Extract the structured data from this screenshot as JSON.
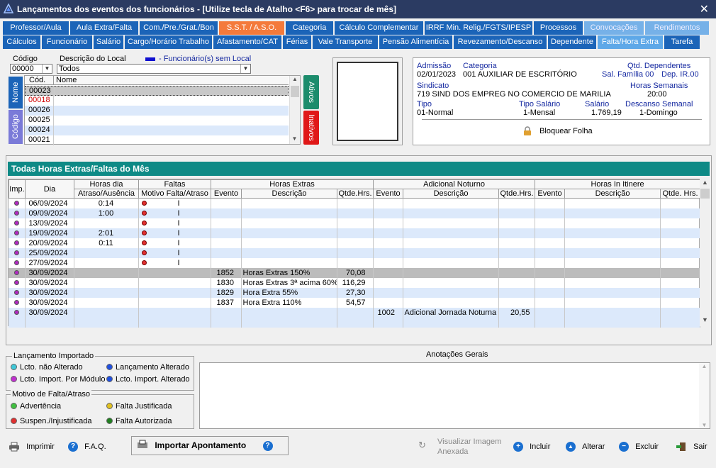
{
  "window": {
    "title": "Lançamentos dos eventos dos funcionários - [Utilize tecla de Atalho <F6> para trocar de mês]"
  },
  "tabs_row1": [
    {
      "label": "Professor/Aula",
      "w": 93,
      "style": "blue"
    },
    {
      "label": "Aula Extra/Falta",
      "w": 96,
      "style": "blue"
    },
    {
      "label": "Com./Pre./Grat./Bon",
      "w": 110,
      "style": "blue"
    },
    {
      "label": "S.S.T. / A.S.O.",
      "w": 92,
      "style": "orange"
    },
    {
      "label": "Categoria",
      "w": 67,
      "style": "blue"
    },
    {
      "label": "Cálculo Complementar",
      "w": 125,
      "style": "blue"
    },
    {
      "label": "IRRF Min. Relig./FGTS/IPESP",
      "w": 152,
      "style": "blue"
    },
    {
      "label": "Processos",
      "w": 69,
      "style": "blue"
    },
    {
      "label": "Convocações",
      "w": 84,
      "style": "light"
    },
    {
      "label": "Rendimentos",
      "w": 90,
      "style": "light"
    }
  ],
  "tabs_row2": [
    {
      "label": "Cálculos",
      "w": 53,
      "style": "blue"
    },
    {
      "label": "Funcionário",
      "w": 71,
      "style": "blue"
    },
    {
      "label": "Salário",
      "w": 42,
      "style": "blue"
    },
    {
      "label": "Cargo/Horário Trabalho",
      "w": 123,
      "style": "blue"
    },
    {
      "label": "Afastamento/CAT",
      "w": 96,
      "style": "blue"
    },
    {
      "label": "Férias",
      "w": 40,
      "style": "blue"
    },
    {
      "label": "Vale Transporte",
      "w": 92,
      "style": "blue"
    },
    {
      "label": "Pensão Alimentícia",
      "w": 103,
      "style": "blue"
    },
    {
      "label": "Revezamento/Descanso",
      "w": 131,
      "style": "blue"
    },
    {
      "label": "Dependente",
      "w": 68,
      "style": "blue"
    },
    {
      "label": "Falta/Hora Extra",
      "w": 92,
      "style": "active"
    },
    {
      "label": "Tarefa",
      "w": 50,
      "style": "blue"
    }
  ],
  "filter": {
    "codigo_label": "Código",
    "codigo_value": "00000",
    "descricao_label": "Descrição do Local",
    "descricao_value": "Todos",
    "legend_text": "- Funcionário(s) sem Local",
    "legend_color": "#1010d0"
  },
  "emp_list": {
    "side_tabs": [
      "Nome",
      "Código"
    ],
    "status_tabs": [
      "Ativos",
      "Inativos"
    ],
    "col_cod": "Cód.",
    "col_nome": "Nome",
    "rows": [
      {
        "cod": "00023",
        "nome": "",
        "red": false
      },
      {
        "cod": "00018",
        "nome": "",
        "red": true
      },
      {
        "cod": "00026",
        "nome": "",
        "red": false
      },
      {
        "cod": "00025",
        "nome": "",
        "red": false
      },
      {
        "cod": "00024",
        "nome": "",
        "red": false
      },
      {
        "cod": "00021",
        "nome": "",
        "red": false
      }
    ]
  },
  "info": {
    "admissao_label": "Admissão",
    "admissao": "02/01/2023",
    "categoria_label": "Categoria",
    "categoria": "001  AUXILIAR DE ESCRITÓRIO",
    "qtd_dep_label": "Qtd. Dependentes",
    "sal_familia": "Sal. Família 00",
    "dep_ir": "Dep. IR.00",
    "sindicato_label": "Sindicato",
    "sindicato": "719  SIND DOS EMPREG NO COMERCIO DE MARILIA",
    "horas_sem_label": "Horas Semanais",
    "horas_sem": "20:00",
    "tipo_label": "Tipo",
    "tipo": "01-Normal",
    "tipo_sal_label": "Tipo Salário",
    "tipo_sal": "1-Mensal",
    "salario_label": "Salário",
    "salario": "1.769,19",
    "descanso_label": "Descanso Semanal",
    "descanso": "1-Domingo",
    "bloquear": "Bloquear Folha"
  },
  "grid": {
    "title": "Todas Horas Extras/Faltas  do Mês",
    "groups": {
      "horas_dia": "Horas dia",
      "faltas": "Faltas",
      "horas_extras": "Horas Extras",
      "adicional": "Adicional Noturno",
      "in_itinere": "Horas In Itinere"
    },
    "cols": {
      "imp": "Imp.",
      "dia": "Dia",
      "atraso": "Atraso/Ausência",
      "motivo": "Motivo Falta/Atraso",
      "evento": "Evento",
      "descricao": "Descrição",
      "qtde": "Qtde.Hrs.",
      "qtde2": "Qtde. Hrs."
    },
    "rows": [
      {
        "dia": "06/09/2024",
        "atraso": "0:14",
        "falta": true,
        "mi": "I",
        "he_ev": "",
        "he_desc": "",
        "he_q": "",
        "an_ev": "",
        "an_desc": "",
        "an_q": ""
      },
      {
        "dia": "09/09/2024",
        "atraso": "1:00",
        "falta": true,
        "mi": "I",
        "he_ev": "",
        "he_desc": "",
        "he_q": "",
        "an_ev": "",
        "an_desc": "",
        "an_q": ""
      },
      {
        "dia": "13/09/2024",
        "atraso": "",
        "falta": true,
        "mi": "I",
        "he_ev": "",
        "he_desc": "",
        "he_q": "",
        "an_ev": "",
        "an_desc": "",
        "an_q": ""
      },
      {
        "dia": "19/09/2024",
        "atraso": "2:01",
        "falta": true,
        "mi": "I",
        "he_ev": "",
        "he_desc": "",
        "he_q": "",
        "an_ev": "",
        "an_desc": "",
        "an_q": ""
      },
      {
        "dia": "20/09/2024",
        "atraso": "0:11",
        "falta": true,
        "mi": "I",
        "he_ev": "",
        "he_desc": "",
        "he_q": "",
        "an_ev": "",
        "an_desc": "",
        "an_q": ""
      },
      {
        "dia": "25/09/2024",
        "atraso": "",
        "falta": true,
        "mi": "I",
        "he_ev": "",
        "he_desc": "",
        "he_q": "",
        "an_ev": "",
        "an_desc": "",
        "an_q": ""
      },
      {
        "dia": "27/09/2024",
        "atraso": "",
        "falta": true,
        "mi": "I",
        "he_ev": "",
        "he_desc": "",
        "he_q": "",
        "an_ev": "",
        "an_desc": "",
        "an_q": ""
      },
      {
        "dia": "30/09/2024",
        "atraso": "",
        "falta": false,
        "mi": "",
        "he_ev": "1852",
        "he_desc": "Horas Extras 150%",
        "he_q": "70,08",
        "an_ev": "",
        "an_desc": "",
        "an_q": ""
      },
      {
        "dia": "30/09/2024",
        "atraso": "",
        "falta": false,
        "mi": "",
        "he_ev": "1830",
        "he_desc": "Horas Extras 3ª acima 60%",
        "he_q": "116,29",
        "an_ev": "",
        "an_desc": "",
        "an_q": ""
      },
      {
        "dia": "30/09/2024",
        "atraso": "",
        "falta": false,
        "mi": "",
        "he_ev": "1829",
        "he_desc": "Hora Extra 55%",
        "he_q": "27,30",
        "an_ev": "",
        "an_desc": "",
        "an_q": ""
      },
      {
        "dia": "30/09/2024",
        "atraso": "",
        "falta": false,
        "mi": "",
        "he_ev": "1837",
        "he_desc": "Hora Extra 110%",
        "he_q": "54,57",
        "an_ev": "",
        "an_desc": "",
        "an_q": ""
      },
      {
        "dia": "30/09/2024",
        "atraso": "",
        "falta": false,
        "mi": "",
        "he_ev": "",
        "he_desc": "",
        "he_q": "",
        "an_ev": "1002",
        "an_desc": "Adicional Jornada Noturna",
        "an_q": "20,55"
      }
    ]
  },
  "legend": {
    "importado_title": "Lançamento Importado",
    "nao_alterado": "Lcto. não Alterado",
    "alterado": "Lançamento Alterado",
    "por_modulo": "Lcto. Import. Por Módulo",
    "import_alterado": "Lcto. Import. Alterado",
    "motivo_title": "Motivo de Falta/Atraso",
    "advertencia": "Advertência",
    "justificada": "Falta Justificada",
    "suspen": "Suspen./Injustificada",
    "autorizada": "Falta Autorizada",
    "colors": {
      "cyan": "#3fc8d8",
      "blue": "#2050e0",
      "magenta": "#c030d0",
      "green": "#40c040",
      "yellow": "#e0c020",
      "red": "#e03030",
      "dkgreen": "#208020"
    }
  },
  "anotacoes": {
    "title": "Anotações Gerais"
  },
  "footer": {
    "imprimir": "Imprimir",
    "faq": "F.A.Q.",
    "importar": "Importar Apontamento",
    "visualizar": "Visualizar Imagem",
    "anexada": "Anexada",
    "incluir": "Incluir",
    "alterar": "Alterar",
    "excluir": "Excluir",
    "sair": "Sair"
  }
}
